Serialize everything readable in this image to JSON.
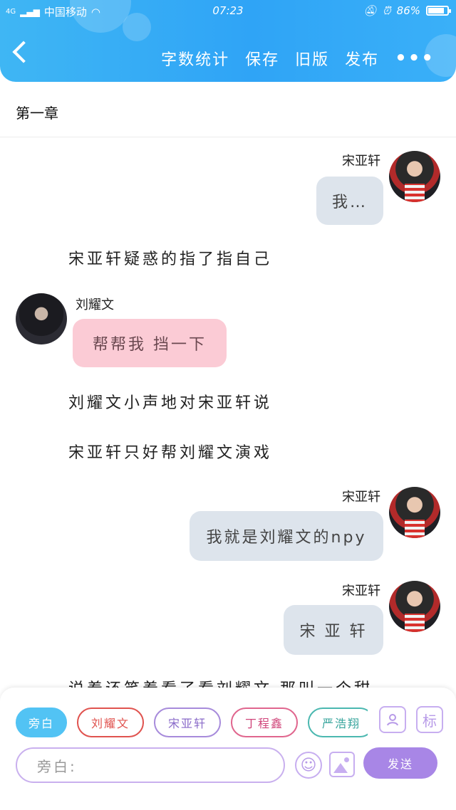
{
  "status_bar": {
    "network": "4G",
    "carrier": "中国移动",
    "time": "07:23",
    "battery_text": "86%",
    "battery_level": 0.86
  },
  "header": {
    "actions": [
      "字数统计",
      "保存",
      "旧版",
      "发布"
    ],
    "more": "•••",
    "accent": "#2fa4f6"
  },
  "chapter": {
    "title": "第一章"
  },
  "messages": [
    {
      "type": "char",
      "side": "right",
      "name": "宋亚轩",
      "text": "我…"
    },
    {
      "type": "narration",
      "text": "宋亚轩疑惑的指了指自己"
    },
    {
      "type": "char",
      "side": "left",
      "name": "刘耀文",
      "text": "帮帮我 挡一下"
    },
    {
      "type": "narration",
      "text": "刘耀文小声地对宋亚轩说"
    },
    {
      "type": "narration",
      "text": "宋亚轩只好帮刘耀文演戏"
    },
    {
      "type": "char",
      "side": "right",
      "name": "宋亚轩",
      "text": "我就是刘耀文的npy"
    },
    {
      "type": "char",
      "side": "right",
      "name": "宋亚轩",
      "text": "宋 亚 轩"
    },
    {
      "type": "narration",
      "text": "说着还笑着看了看刘耀文 那叫一个甜"
    }
  ],
  "composer": {
    "roles": [
      {
        "label": "旁白",
        "active": true
      },
      {
        "label": "刘耀文",
        "active": false
      },
      {
        "label": "宋亚轩",
        "active": false
      },
      {
        "label": "丁程鑫",
        "active": false
      },
      {
        "label": "严浩翔",
        "active": false
      }
    ],
    "role_icon": "person-card-icon",
    "tag_label": "标",
    "input_placeholder": "旁白:",
    "emoji_icon": "smiley-icon",
    "image_icon": "image-icon",
    "send_label": "发送",
    "send_color": "#a886e6"
  }
}
